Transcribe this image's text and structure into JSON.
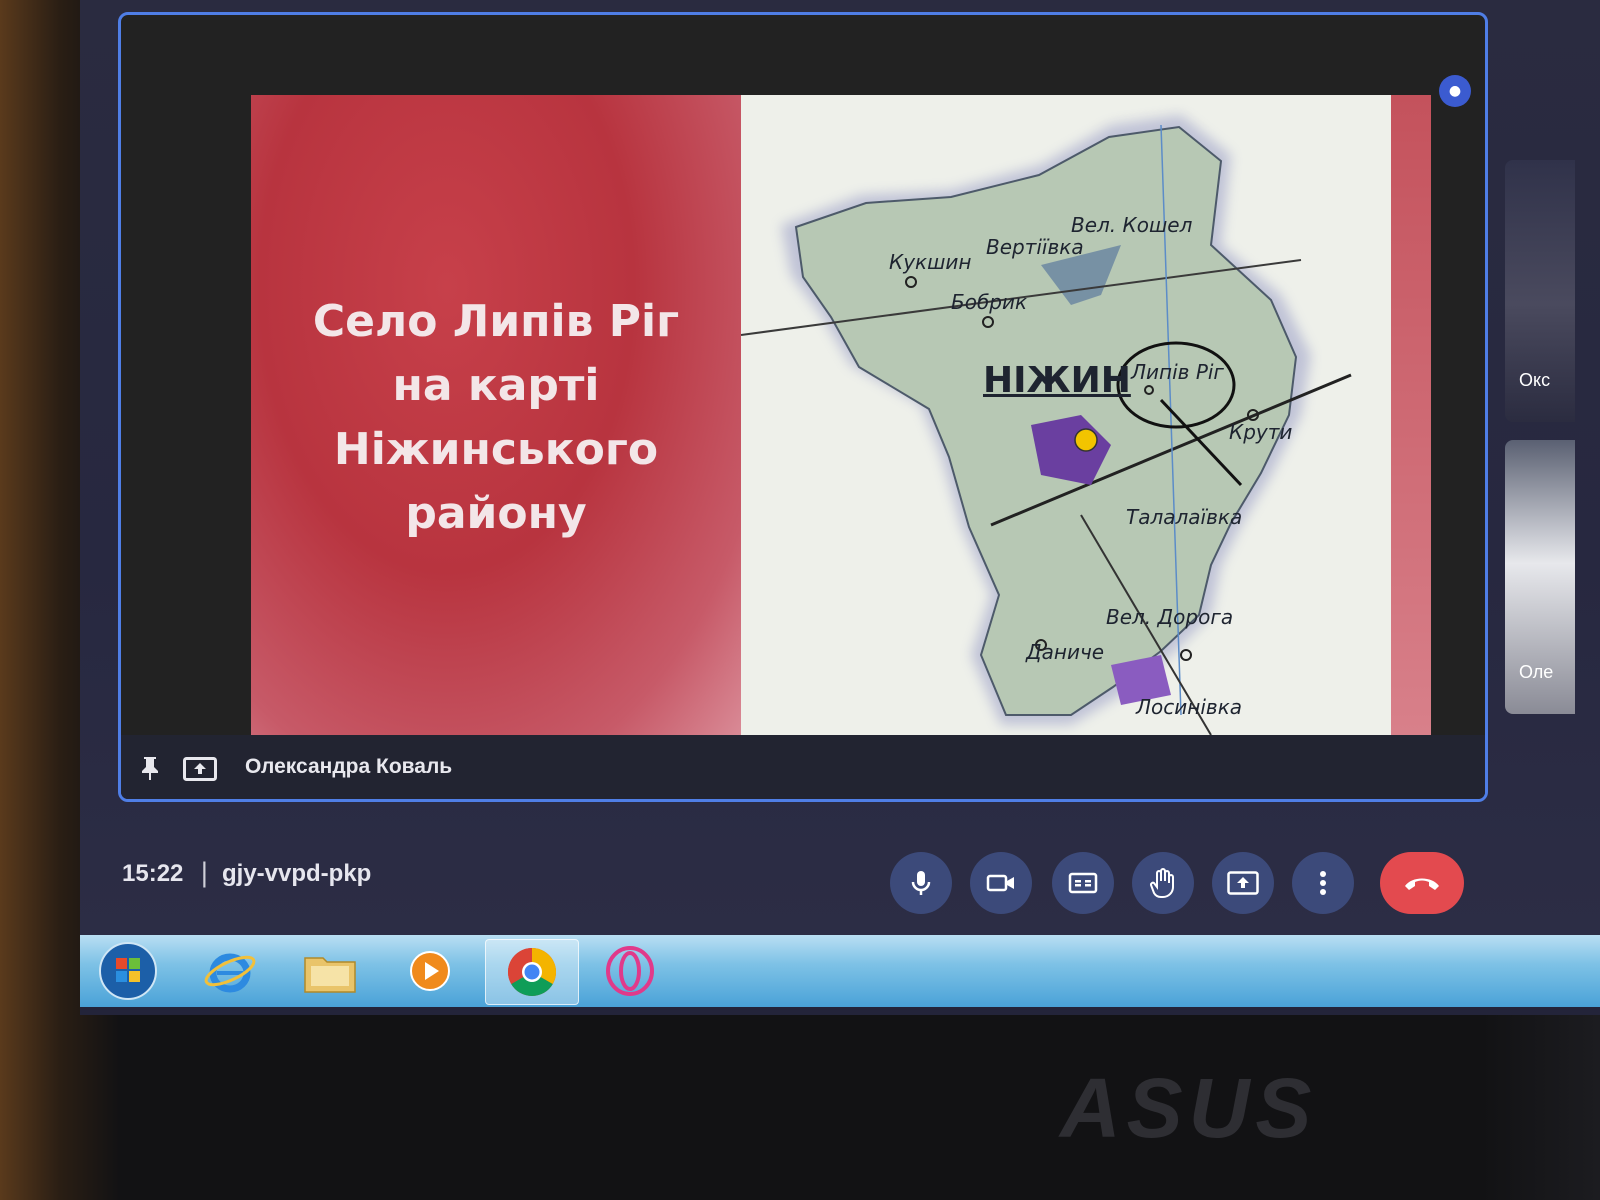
{
  "slide": {
    "title": "Село Липів Ріг\nна карті\nНіжинського\nрайону",
    "map_labels": {
      "vel_koshel": "Вел. Кошел",
      "vertiivka": "Вертіївка",
      "kukshyn": "Кукшин",
      "bobryk": "Бобрик",
      "nizhyn": "НІЖИН",
      "lypiv_rih": "Липів Ріг",
      "kruty": "Крути",
      "talalaivka": "Талалаївка",
      "vel_doroga": "Вел. Дорога",
      "danyche": "Даниче",
      "losynivka": "Лосинівка"
    },
    "colors": {
      "left_panel": "#b8343f",
      "map_region": "#b7c8b4",
      "city": "#6a3fa0",
      "marker": "#f2c400"
    }
  },
  "presenter": {
    "name": "Олександра Коваль"
  },
  "side_participants": [
    {
      "name": "Окс"
    },
    {
      "name": "Оле"
    }
  ],
  "meeting": {
    "time": "15:22",
    "separator": "|",
    "code": "gjy-vvpd-pkp"
  },
  "controls": [
    {
      "id": "mic",
      "icon": "microphone-icon"
    },
    {
      "id": "camera",
      "icon": "camera-icon"
    },
    {
      "id": "captions",
      "icon": "captions-icon"
    },
    {
      "id": "hand",
      "icon": "raise-hand-icon"
    },
    {
      "id": "present",
      "icon": "present-screen-icon"
    },
    {
      "id": "more",
      "icon": "more-vertical-icon"
    },
    {
      "id": "end_call",
      "icon": "end-call-icon",
      "color": "#e34a4f"
    }
  ],
  "taskbar": {
    "items": [
      "start-orb-icon",
      "internet-explorer-icon",
      "file-explorer-icon",
      "media-player-icon",
      "chrome-icon",
      "opera-icon"
    ],
    "active": "chrome-icon"
  },
  "device": {
    "brand": "ASUS"
  }
}
